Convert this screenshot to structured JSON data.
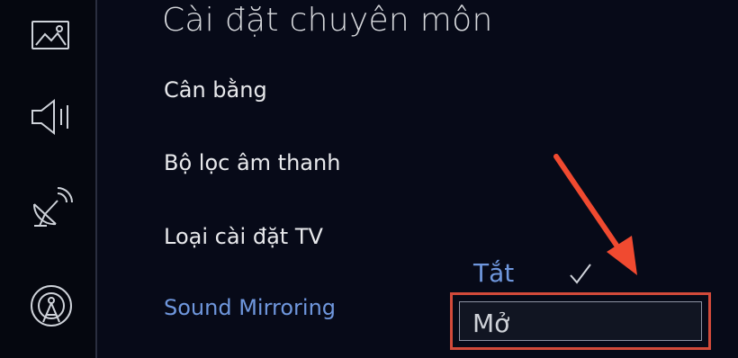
{
  "page": {
    "title": "Cài đặt chuyên môn"
  },
  "sidebar": {
    "items": [
      {
        "icon": "picture-icon"
      },
      {
        "icon": "sound-icon"
      },
      {
        "icon": "broadcast-icon"
      },
      {
        "icon": "network-icon"
      }
    ]
  },
  "menu": {
    "items": [
      {
        "label": "Cân bằng"
      },
      {
        "label": "Bộ lọc âm thanh"
      },
      {
        "label": "Loại cài đặt TV"
      },
      {
        "label": "Sound Mirroring",
        "selected": true
      }
    ]
  },
  "options": {
    "off_label": "Tắt",
    "on_label": "Mở",
    "checked": "off"
  },
  "colors": {
    "background": "#070a18",
    "accent": "#6f97dd",
    "highlight_box": "#d24a3a",
    "arrow": "#f04a30"
  }
}
